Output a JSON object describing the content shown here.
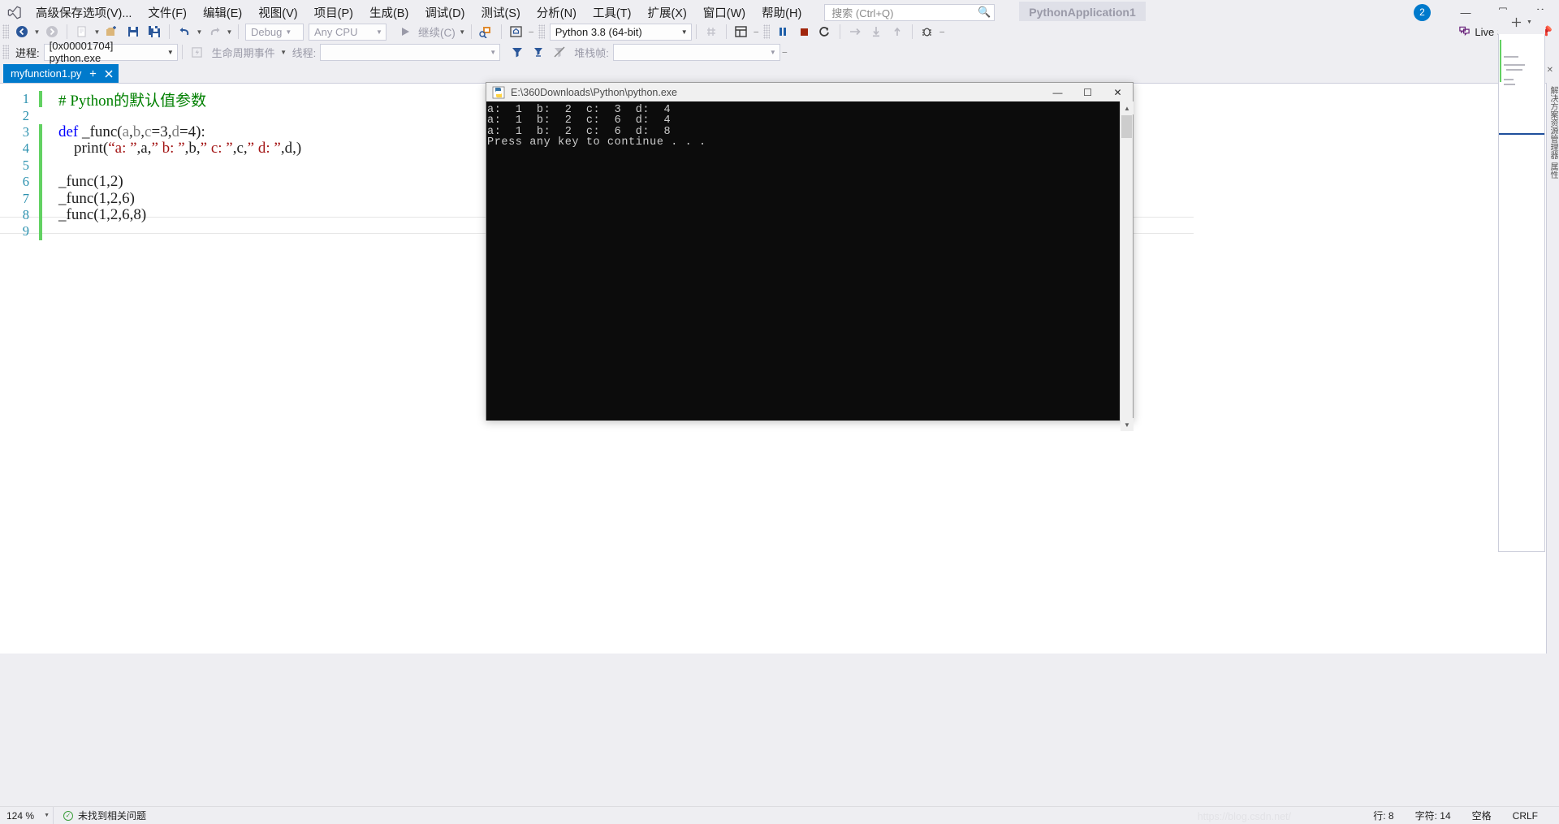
{
  "window": {
    "project_name": "PythonApplication1",
    "notification_count": "2",
    "minimize": "—",
    "maximize": "☐",
    "close": "✕"
  },
  "menubar": {
    "logo": "vs-logo-icon",
    "items": [
      "高级保存选项(V)...",
      "文件(F)",
      "编辑(E)",
      "视图(V)",
      "项目(P)",
      "生成(B)",
      "调试(D)",
      "测试(S)",
      "分析(N)",
      "工具(T)",
      "扩展(X)",
      "窗口(W)",
      "帮助(H)"
    ]
  },
  "search": {
    "placeholder": "搜索 (Ctrl+Q)",
    "icon": "search-icon"
  },
  "live_share": {
    "label": "Live Share",
    "icon": "live-share-icon",
    "pin_icon": "pin-icon"
  },
  "toolbar": {
    "nav_back": "←",
    "nav_forward": "→",
    "new_item": "new-item-icon",
    "open_file": "open-file-icon",
    "save": "save-icon",
    "save_all": "save-all-icon",
    "undo": "undo-icon",
    "redo": "redo-icon",
    "config_value": "Debug",
    "platform_value": "Any CPU",
    "continue_label": "继续(C)",
    "attach_icon": "attach-process-icon",
    "preview_icon": "preview-icon",
    "interpreter_value": "Python 3.8 (64-bit)",
    "hash_icon": "hash-icon",
    "layout_icon": "layout-icon",
    "pause_icon": "pause-icon",
    "stop_icon": "stop-icon",
    "restart_icon": "restart-icon",
    "step_over_icon": "step-over-icon",
    "step_into_icon": "step-into-icon",
    "step_out_icon": "step-out-icon",
    "bug_icon": "bug-icon"
  },
  "debugbar": {
    "process_label": "进程:",
    "process_value": "[0x00001704] python.exe",
    "lifecycle_icon": "lifecycle-icon",
    "lifecycle_label": "生命周期事件",
    "thread_label": "线程:",
    "thread_value": "",
    "filter_icon": "filter-icon",
    "filter_down_icon": "filter-down-icon",
    "nofilter_icon": "no-filter-icon",
    "stack_label": "堆栈帧:",
    "stack_value": ""
  },
  "tab": {
    "title": "myfunction1.py",
    "pin_icon": "pin-icon",
    "close_icon": "close-icon"
  },
  "editor": {
    "lines": [
      {
        "number": "1",
        "modified": true,
        "tokens": [
          {
            "t": "# Python的默认值参数",
            "c": "tok-comment"
          }
        ]
      },
      {
        "number": "2",
        "modified": false,
        "tokens": []
      },
      {
        "number": "3",
        "modified": true,
        "tokens": [
          {
            "t": "def",
            "c": "tok-kw"
          },
          {
            "t": " _func(",
            "c": "tok-fn"
          },
          {
            "t": "a",
            "c": "tok-param"
          },
          {
            "t": ",",
            "c": "tok-fn"
          },
          {
            "t": "b",
            "c": "tok-param"
          },
          {
            "t": ",",
            "c": "tok-fn"
          },
          {
            "t": "c",
            "c": "tok-param"
          },
          {
            "t": "=3,",
            "c": "tok-fn"
          },
          {
            "t": "d",
            "c": "tok-param"
          },
          {
            "t": "=4):",
            "c": "tok-fn"
          }
        ]
      },
      {
        "number": "4",
        "modified": true,
        "tokens": [
          {
            "t": "    print(",
            "c": "tok-fn"
          },
          {
            "t": "“a: ”",
            "c": "tok-str"
          },
          {
            "t": ",a,",
            "c": "tok-fn"
          },
          {
            "t": "” b: ”",
            "c": "tok-str"
          },
          {
            "t": ",b,",
            "c": "tok-fn"
          },
          {
            "t": "” c: ”",
            "c": "tok-str"
          },
          {
            "t": ",c,",
            "c": "tok-fn"
          },
          {
            "t": "” d: ”",
            "c": "tok-str"
          },
          {
            "t": ",d,)",
            "c": "tok-fn"
          }
        ]
      },
      {
        "number": "5",
        "modified": true,
        "tokens": []
      },
      {
        "number": "6",
        "modified": true,
        "tokens": [
          {
            "t": "_func(1,2)",
            "c": "tok-fn"
          }
        ]
      },
      {
        "number": "7",
        "modified": true,
        "tokens": [
          {
            "t": "_func(1,2,6)",
            "c": "tok-fn"
          }
        ]
      },
      {
        "number": "8",
        "modified": true,
        "tokens": [
          {
            "t": "_func(1,2,6,8)",
            "c": "tok-fn"
          }
        ]
      },
      {
        "number": "9",
        "modified": true,
        "tokens": []
      }
    ]
  },
  "console": {
    "title": "E:\\360Downloads\\Python\\python.exe",
    "icon": "python-console-icon",
    "minimize": "—",
    "maximize": "☐",
    "close": "✕",
    "lines": [
      "a:  1  b:  2  c:  3  d:  4",
      "a:  1  b:  2  c:  6  d:  4",
      "a:  1  b:  2  c:  6  d:  8",
      "Press any key to continue . . ."
    ],
    "scroll_up": "▲",
    "scroll_down": "▼"
  },
  "rightrail": {
    "labels": [
      "解决方案资源管理器",
      "属性"
    ]
  },
  "statusbar": {
    "zoom": "124 %",
    "zoom_arrow": "▾",
    "issues": "未找到相关问题",
    "ok_icon": "check-circle-icon",
    "line": "行: 8",
    "column": "字符: 14",
    "insert_mode": "空格",
    "eol": "CRLF",
    "watermark": "https://blog.csdn.net/"
  }
}
